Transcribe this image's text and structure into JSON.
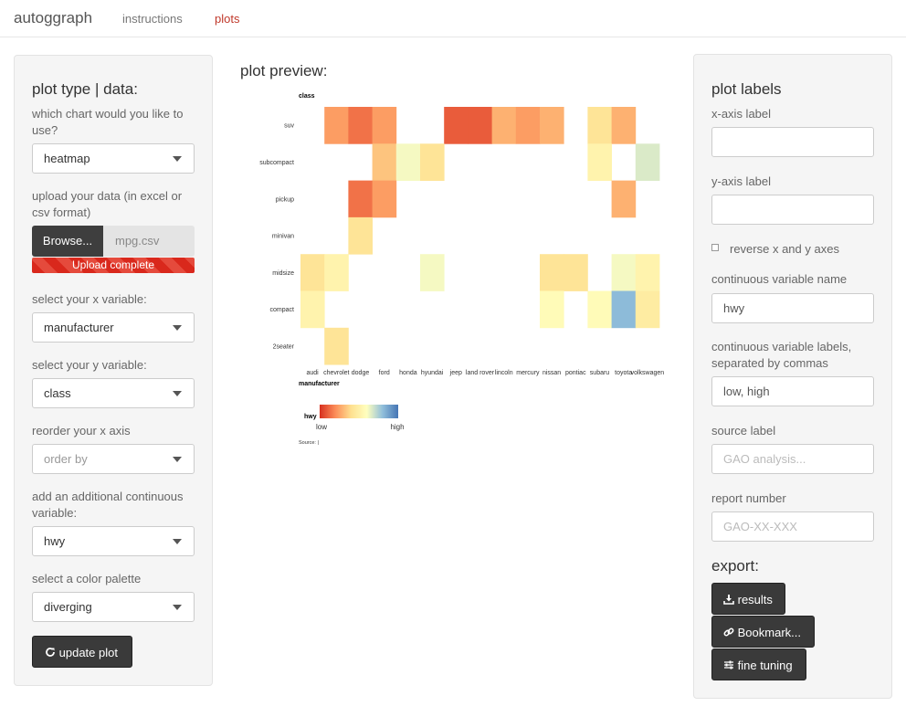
{
  "navbar": {
    "brand": "autoggraph",
    "links": [
      "instructions",
      "plots"
    ]
  },
  "left_panel": {
    "title": "plot type | data:",
    "chart_label": "which chart would you like to use?",
    "chart_value": "heatmap",
    "upload_label": "upload your data (in excel or csv format)",
    "browse_label": "Browse...",
    "file_name": "mpg.csv",
    "upload_status": "Upload complete",
    "upload_progress": 1.0,
    "x_label": "select your x variable:",
    "x_value": "manufacturer",
    "y_label": "select your y variable:",
    "y_value": "class",
    "reorder_label": "reorder your x axis",
    "reorder_placeholder": "order by",
    "continuous_label": "add an additional continuous variable:",
    "continuous_value": "hwy",
    "palette_label": "select a color palette",
    "palette_value": "diverging",
    "update_button": "update plot"
  },
  "preview": {
    "title": "plot preview:"
  },
  "right_panel": {
    "title": "plot labels",
    "xaxis_label": "x-axis label",
    "xaxis_value": "",
    "yaxis_label": "y-axis label",
    "yaxis_value": "",
    "reverse_label": "reverse x and y axes",
    "reverse_checked": false,
    "cont_name_label": "continuous variable name",
    "cont_name_value": "hwy",
    "cont_labels_label": "continuous variable labels, separated by commas",
    "cont_labels_value": "low, high",
    "source_label": "source label",
    "source_placeholder": "GAO analysis...",
    "report_label": "report number",
    "report_placeholder": "GAO-XX-XXX",
    "export_title": "export:",
    "results_button": "results",
    "bookmark_button": "Bookmark...",
    "fine_tuning_button": "fine tuning"
  },
  "colors": {
    "accent": "#c0392b",
    "panel_bg": "#f5f5f5",
    "button_dark": "#3a3a3a"
  },
  "icons": {
    "results": "download-icon",
    "bookmark": "link-icon",
    "fine_tuning": "sliders-icon",
    "update": "refresh-icon"
  },
  "chart_data": {
    "type": "heatmap",
    "xlabel": "manufacturer",
    "ylabel": "class",
    "x_categories": [
      "audi",
      "chevrolet",
      "dodge",
      "ford",
      "honda",
      "hyundai",
      "jeep",
      "land rover",
      "lincoln",
      "mercury",
      "nissan",
      "pontiac",
      "subaru",
      "toyota",
      "volkswagen"
    ],
    "y_categories": [
      "suv",
      "subcompact",
      "pickup",
      "minivan",
      "midsize",
      "compact",
      "2seater"
    ],
    "legend_title": "hwy",
    "legend_labels": [
      "low",
      "high"
    ],
    "colorscale": [
      "#d7301f",
      "#fc8d59",
      "#fee090",
      "#ffffbf",
      "#91bfdb",
      "#4575b4"
    ],
    "color_range": [
      12,
      33
    ],
    "source_text": "Source:  |",
    "cells": [
      {
        "x": "chevrolet",
        "y": "suv",
        "value": 17
      },
      {
        "x": "dodge",
        "y": "suv",
        "value": 15
      },
      {
        "x": "ford",
        "y": "suv",
        "value": 17
      },
      {
        "x": "jeep",
        "y": "suv",
        "value": 14
      },
      {
        "x": "land rover",
        "y": "suv",
        "value": 14
      },
      {
        "x": "lincoln",
        "y": "suv",
        "value": 18
      },
      {
        "x": "mercury",
        "y": "suv",
        "value": 17
      },
      {
        "x": "nissan",
        "y": "suv",
        "value": 18
      },
      {
        "x": "subaru",
        "y": "suv",
        "value": 21
      },
      {
        "x": "toyota",
        "y": "suv",
        "value": 18
      },
      {
        "x": "ford",
        "y": "subcompact",
        "value": 19
      },
      {
        "x": "honda",
        "y": "subcompact",
        "value": 25
      },
      {
        "x": "hyundai",
        "y": "subcompact",
        "value": 21
      },
      {
        "x": "subaru",
        "y": "subcompact",
        "value": 23
      },
      {
        "x": "volkswagen",
        "y": "subcompact",
        "value": 26
      },
      {
        "x": "dodge",
        "y": "pickup",
        "value": 15
      },
      {
        "x": "ford",
        "y": "pickup",
        "value": 17
      },
      {
        "x": "toyota",
        "y": "pickup",
        "value": 18
      },
      {
        "x": "dodge",
        "y": "minivan",
        "value": 21
      },
      {
        "x": "audi",
        "y": "midsize",
        "value": 21
      },
      {
        "x": "chevrolet",
        "y": "midsize",
        "value": 23
      },
      {
        "x": "hyundai",
        "y": "midsize",
        "value": 25
      },
      {
        "x": "nissan",
        "y": "midsize",
        "value": 21
      },
      {
        "x": "pontiac",
        "y": "midsize",
        "value": 21
      },
      {
        "x": "toyota",
        "y": "midsize",
        "value": 25
      },
      {
        "x": "volkswagen",
        "y": "midsize",
        "value": 23
      },
      {
        "x": "audi",
        "y": "compact",
        "value": 23
      },
      {
        "x": "nissan",
        "y": "compact",
        "value": 24
      },
      {
        "x": "subaru",
        "y": "compact",
        "value": 24
      },
      {
        "x": "toyota",
        "y": "compact",
        "value": 29
      },
      {
        "x": "volkswagen",
        "y": "compact",
        "value": 22
      },
      {
        "x": "chevrolet",
        "y": "2seater",
        "value": 21
      }
    ],
    "grid": false,
    "legend_position": "bottom"
  }
}
